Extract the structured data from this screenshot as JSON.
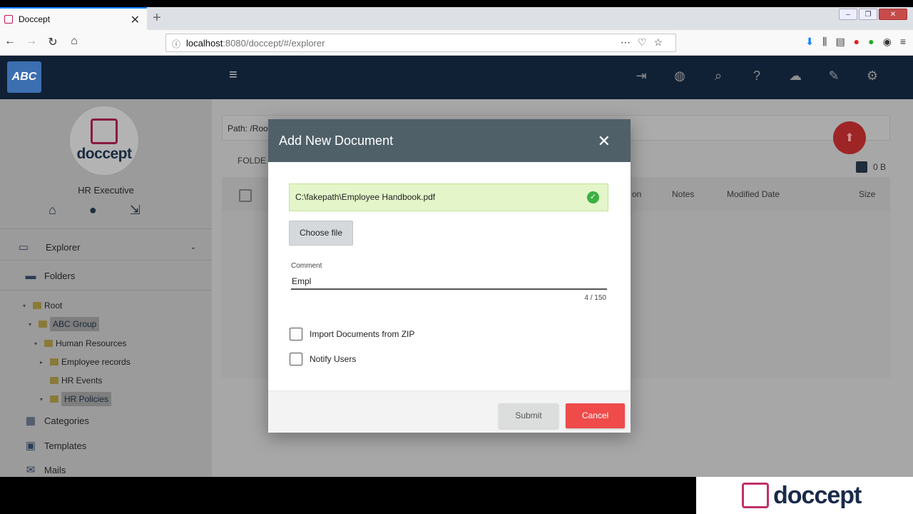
{
  "browser": {
    "tab_title": "Doccept",
    "url_host": "localhost",
    "url_rest": ":8080/doccept/#/explorer"
  },
  "app": {
    "logo_text": "ABC",
    "brand": "doccept",
    "role": "HR Executive",
    "sidebar": {
      "explorer": "Explorer",
      "folders": "Folders",
      "tree": [
        {
          "label": "Root"
        },
        {
          "label": "ABC Group"
        },
        {
          "label": "Human Resources"
        },
        {
          "label": "Employee records"
        },
        {
          "label": "HR Events"
        },
        {
          "label": "HR Policies"
        }
      ],
      "categories": "Categories",
      "templates": "Templates",
      "mails": "Mails"
    },
    "main": {
      "path": "Path: /Roo",
      "folder_tab": "FOLDE",
      "size_label": "0 B",
      "columns": {
        "on": "on",
        "notes": "Notes",
        "modified": "Modified Date",
        "size": "Size"
      }
    }
  },
  "modal": {
    "title": "Add New Document",
    "file_path": "C:\\fakepath\\Employee Handbook.pdf",
    "choose_label": "Choose file",
    "comment_label": "Comment",
    "comment_value": "Empl",
    "char_count": "4 / 150",
    "opt_zip": "Import Documents from ZIP",
    "opt_notify": "Notify Users",
    "submit": "Submit",
    "cancel": "Cancel"
  },
  "watermark": {
    "text": "doccept"
  },
  "colors": {
    "topnav": "#102035",
    "modal_header": "#4f6069",
    "cancel": "#ef4b4b",
    "success_bg": "#e3f5c9"
  }
}
